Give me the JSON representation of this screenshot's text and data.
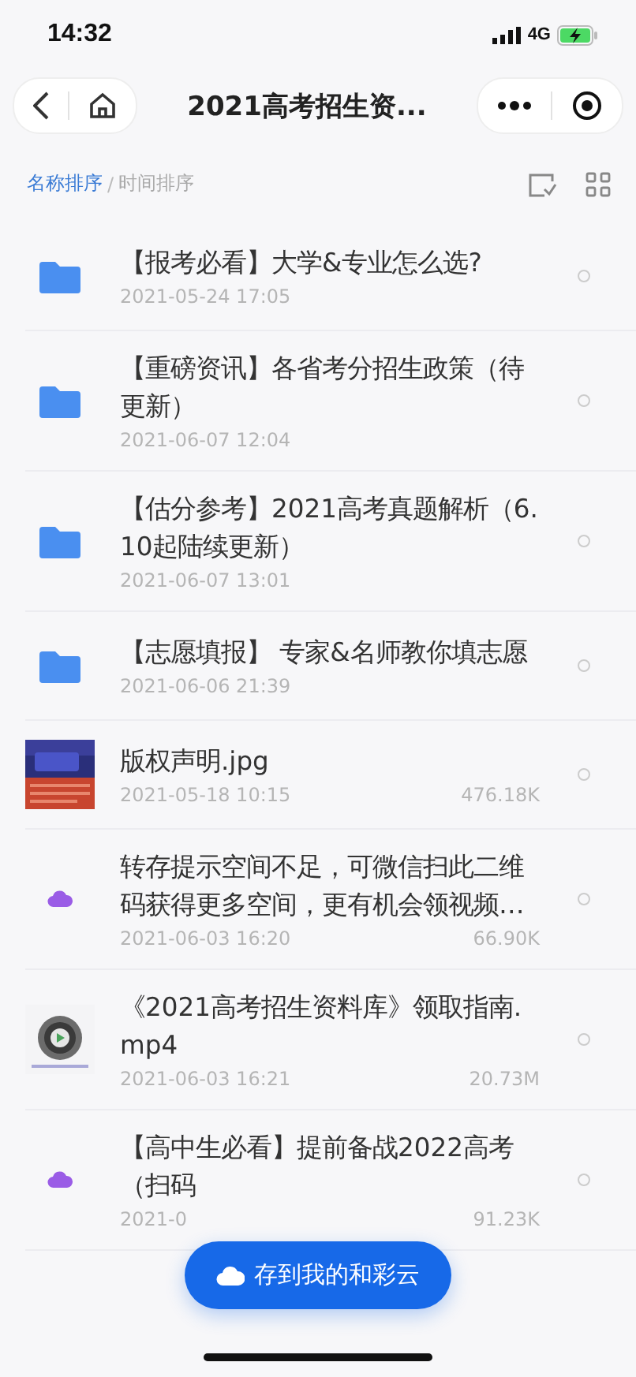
{
  "status_bar": {
    "time": "14:32",
    "network": "4G"
  },
  "nav": {
    "title": "2021高考招生资..."
  },
  "sort": {
    "options": [
      {
        "label": "名称排序",
        "selected": true
      },
      {
        "label": "时间排序",
        "selected": false
      }
    ],
    "separator": "/"
  },
  "files": [
    {
      "kind": "folder",
      "name": "【报考必看】大学&专业怎么选?",
      "date": "2021-05-24 17:05",
      "selected": false
    },
    {
      "kind": "folder",
      "name": "【重磅资讯】各省考分招生政策（待更新）",
      "date": "2021-06-07 12:04",
      "selected": false
    },
    {
      "kind": "folder",
      "name": "【估分参考】2021高考真题解析（6.10起陆续更新）",
      "date": "2021-06-07 13:01",
      "selected": false
    },
    {
      "kind": "folder",
      "name": "【志愿填报】 专家&名师教你填志愿",
      "date": "2021-06-06 21:39",
      "selected": false
    },
    {
      "name": "版权声明.jpg",
      "date": "2021-05-18 10:15",
      "size": "476.18K",
      "selected": false
    },
    {
      "kind": "cloud",
      "name": "转存提示空间不足，可微信扫此二维码获得更多空间，更有机会领视频…",
      "date": "2021-06-03 16:20",
      "size": "66.90K",
      "selected": false
    },
    {
      "kind": "video",
      "name": "《2021高考招生资料库》领取指南.mp4",
      "date": "2021-06-03 16:21",
      "size": "20.73M",
      "selected": false
    },
    {
      "kind": "cloud",
      "name": "【高中生必看】提前备战2022高考（扫码",
      "date": "2021-0",
      "size": "91.23K",
      "selected": false
    }
  ],
  "save_button": {
    "label": "存到我的和彩云"
  }
}
